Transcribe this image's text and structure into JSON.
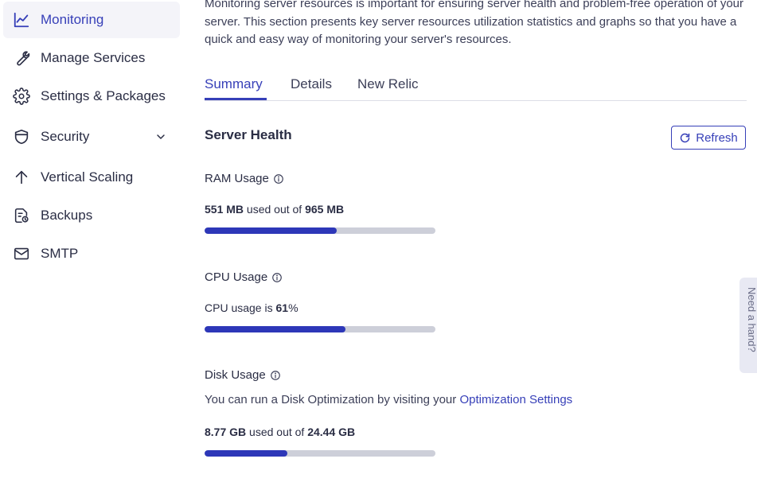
{
  "sidebar": {
    "items": [
      {
        "label": "Monitoring",
        "icon": "chart-line-icon",
        "active": true
      },
      {
        "label": "Manage Services",
        "icon": "wrench-icon"
      },
      {
        "label": "Settings & Packages",
        "icon": "gear-icon"
      },
      {
        "label": "Security",
        "icon": "shield-icon",
        "expandable": true
      },
      {
        "label": "Vertical Scaling",
        "icon": "arrow-up-icon"
      },
      {
        "label": "Backups",
        "icon": "backup-file-icon"
      },
      {
        "label": "SMTP",
        "icon": "envelope-icon"
      }
    ]
  },
  "intro": "Monitoring server resources is important for ensuring server health and problem-free operation of your server. This section presents key server resources utilization statistics and graphs so that you have a quick and easy way of monitoring your server's resources.",
  "tabs": [
    {
      "label": "Summary",
      "active": true
    },
    {
      "label": "Details"
    },
    {
      "label": "New Relic"
    }
  ],
  "server_health": {
    "title": "Server Health",
    "refresh_label": "Refresh",
    "ram": {
      "title": "RAM Usage",
      "used": "551 MB",
      "used_text": "used out of",
      "total": "965 MB",
      "fill_fraction": 0.571
    },
    "cpu": {
      "title": "CPU Usage",
      "text": "CPU usage is",
      "value": "61",
      "unit": "%",
      "fill_fraction": 0.61
    },
    "disk": {
      "title": "Disk Usage",
      "note": "You can run a Disk Optimization by visiting your",
      "link": "Optimization Settings",
      "used": "8.77 GB",
      "used_text": "used out of",
      "total": "24.44 GB",
      "fill_fraction": 0.359
    }
  },
  "help_tab": "Need a hand?",
  "colors": {
    "accent": "#363fb8",
    "bar_fill": "#2d37b8",
    "bar_track": "#cdcfd9",
    "active_bg": "#f4f4f9"
  }
}
